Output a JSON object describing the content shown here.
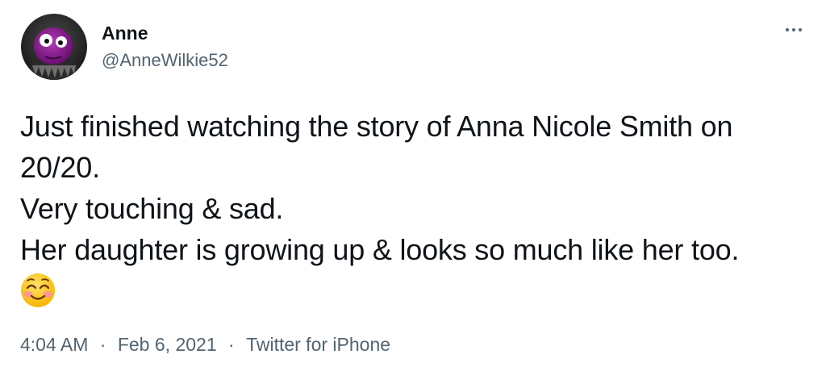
{
  "user": {
    "display_name": "Anne",
    "handle": "@AnneWilkie52",
    "avatar_icon": "purple-monster-avatar"
  },
  "tweet": {
    "lines": [
      "Just finished watching the story of Anna Nicole Smith on",
      "20/20.",
      "Very touching & sad.",
      "Her daughter is growing up & looks so much like her too."
    ],
    "emoji": "smiling-face-with-smiling-eyes-emoji"
  },
  "meta": {
    "time": "4:04 AM",
    "separator": "·",
    "date": "Feb 6, 2021",
    "source": "Twitter for iPhone"
  },
  "more_icon": "more-horizontal-icon",
  "colors": {
    "text": "#0f1419",
    "secondary": "#536471",
    "background": "#ffffff",
    "avatar_purple": "#7a1a7f"
  }
}
